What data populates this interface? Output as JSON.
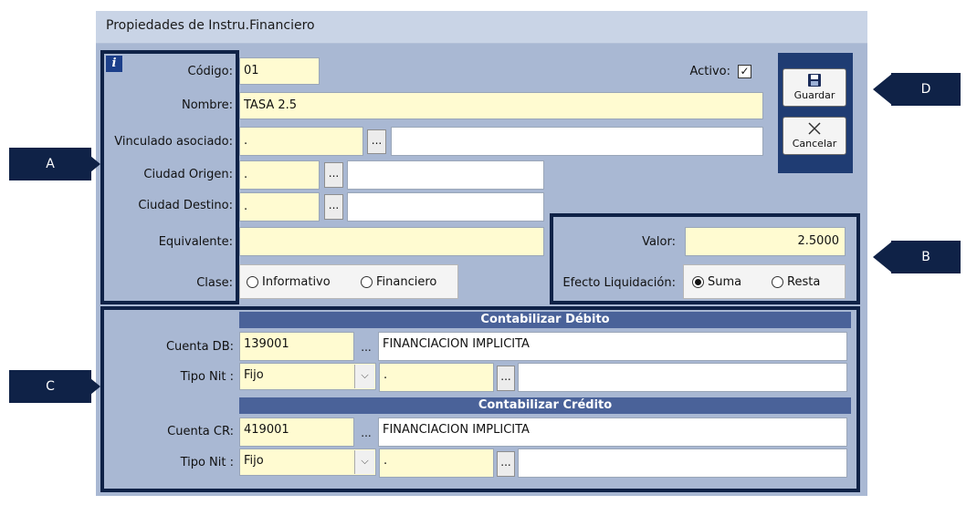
{
  "window": {
    "title": "Propiedades de Instru.Financiero"
  },
  "info_icon": "i",
  "fields": {
    "codigo": {
      "label": "Código:",
      "value": "01"
    },
    "activo": {
      "label": "Activo:",
      "checked": true
    },
    "nombre": {
      "label": "Nombre:",
      "value": "TASA 2.5"
    },
    "vinculado": {
      "label": "Vinculado asociado:",
      "code": ".",
      "name": ""
    },
    "ciudad_origen": {
      "label": "Ciudad Origen:",
      "code": ".",
      "name": ""
    },
    "ciudad_destino": {
      "label": "Ciudad Destino:",
      "code": ".",
      "name": ""
    },
    "equivalente": {
      "label": "Equivalente:",
      "value": ""
    },
    "clase": {
      "label": "Clase:",
      "options": [
        "Informativo",
        "Financiero"
      ],
      "selected": null
    },
    "valor": {
      "label": "Valor:",
      "value": "2.5000"
    },
    "efecto": {
      "label": "Efecto Liquidación:",
      "options": [
        "Suma",
        "Resta"
      ],
      "selected": "Suma"
    }
  },
  "debito": {
    "header": "Contabilizar Débito",
    "cuenta_label": "Cuenta DB:",
    "cuenta": "139001",
    "cuenta_nombre": "FINANCIACION IMPLICITA",
    "tipo_nit_label": "Tipo Nit :",
    "tipo_nit": "Fijo",
    "nit": ".",
    "nit_nombre": ""
  },
  "credito": {
    "header": "Contabilizar Crédito",
    "cuenta_label": "Cuenta CR:",
    "cuenta": "419001",
    "cuenta_nombre": "FINANCIACION IMPLICITA",
    "tipo_nit_label": "Tipo Nit :",
    "tipo_nit": "Fijo",
    "nit": ".",
    "nit_nombre": ""
  },
  "buttons": {
    "guardar": "Guardar",
    "cancelar": "Cancelar",
    "browse": "..."
  },
  "callouts": {
    "a": "A",
    "b": "B",
    "c": "C",
    "d": "D"
  },
  "colors": {
    "frame": "#0f2247",
    "window_bg": "#a9b8d3",
    "field_bg": "#fffbd1",
    "section_header": "#4a6299"
  }
}
